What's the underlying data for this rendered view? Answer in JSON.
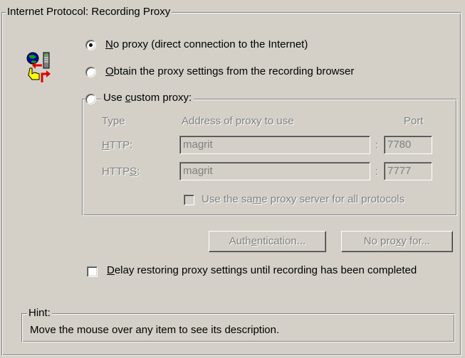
{
  "group_title": "Internet Protocol: Recording Proxy",
  "proxy_options": {
    "no_proxy": {
      "pre": "",
      "accel": "N",
      "post": "o proxy (direct connection to the Internet)",
      "selected": true
    },
    "obtain": {
      "pre": "",
      "accel": "O",
      "post": "btain the proxy settings from the recording browser",
      "selected": false
    },
    "custom": {
      "pre": "Use ",
      "accel": "c",
      "post": "ustom proxy:",
      "selected": false
    }
  },
  "custom_proxy": {
    "col_type": "Type",
    "col_address": "Address of proxy to use",
    "col_port": "Port",
    "rows": [
      {
        "pre": "",
        "accel": "H",
        "post": "TTP:",
        "address": "magrit",
        "sep": ":",
        "port": "7780"
      },
      {
        "pre": "HTTP",
        "accel": "S",
        "post": ":",
        "address": "magrit",
        "sep": ":",
        "port": "7777"
      }
    ],
    "same_proxy": {
      "pre": "Use the sa",
      "accel": "m",
      "post": "e proxy server for all protocols",
      "checked": false
    }
  },
  "buttons": {
    "authentication": {
      "pre": "Auth",
      "accel": "e",
      "post": "ntication..."
    },
    "no_proxy_for": {
      "pre": "No pro",
      "accel": "x",
      "post": "y for..."
    }
  },
  "delay_restore": {
    "pre": "",
    "accel": "D",
    "post": "elay restoring proxy settings until recording has been completed",
    "checked": false
  },
  "hint": {
    "title": "Hint:",
    "text": "Move the mouse over any item to see its description."
  },
  "icon": "proxy-network-icon",
  "colors": {
    "face": "#d4d0c8",
    "disabled_text": "#808080",
    "shadow": "#808080",
    "highlight": "#ffffff"
  }
}
